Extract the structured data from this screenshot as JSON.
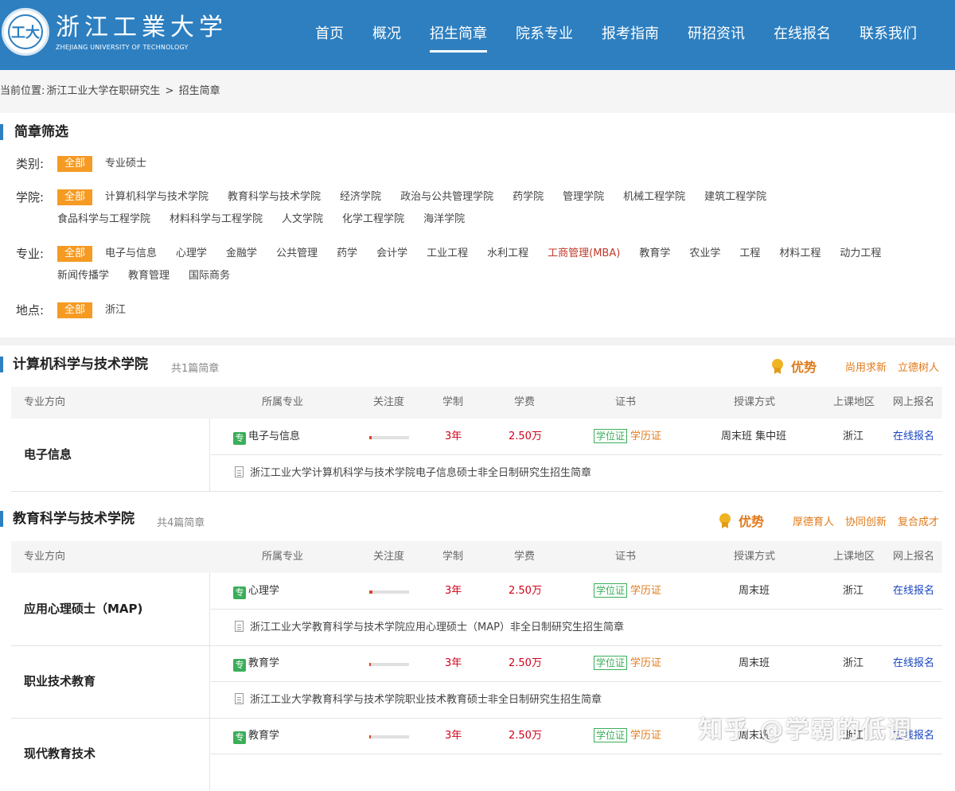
{
  "header": {
    "logo_cn": "浙江工業大学",
    "logo_en": "ZHEJIANG UNIVERSITY OF TECHNOLOGY",
    "logo_seal": "工大",
    "nav": [
      "首页",
      "概况",
      "招生简章",
      "院系专业",
      "报考指南",
      "研招资讯",
      "在线报名",
      "联系我们"
    ],
    "active_nav": "招生简章"
  },
  "breadcrumb": {
    "prefix": "当前位置:",
    "home": "浙江工业大学在职研究生",
    "sep": ">",
    "current": "招生简章"
  },
  "filter": {
    "title": "简章筛选",
    "all_label": "全部",
    "rows": [
      {
        "label": "类别:",
        "options": [
          "专业硕士"
        ]
      },
      {
        "label": "学院:",
        "options": [
          "计算机科学与技术学院",
          "教育科学与技术学院",
          "经济学院",
          "政治与公共管理学院",
          "药学院",
          "管理学院",
          "机械工程学院",
          "建筑工程学院",
          "食品科学与工程学院",
          "材料科学与工程学院",
          "人文学院",
          "化学工程学院",
          "海洋学院"
        ]
      },
      {
        "label": "专业:",
        "options": [
          "电子与信息",
          "心理学",
          "金融学",
          "公共管理",
          "药学",
          "会计学",
          "工业工程",
          "水利工程",
          "工商管理(MBA)",
          "教育学",
          "农业学",
          "工程",
          "材料工程",
          "动力工程",
          "新闻传播学",
          "教育管理",
          "国际商务"
        ],
        "highlight": "工商管理(MBA)"
      },
      {
        "label": "地点:",
        "options": [
          "浙江"
        ]
      }
    ]
  },
  "table_headers": [
    "专业方向",
    "所属专业",
    "关注度",
    "学制",
    "学费",
    "证书",
    "授课方式",
    "上课地区",
    "网上报名"
  ],
  "colleges": [
    {
      "name": "计算机科学与技术学院",
      "count": "共1篇简章",
      "adv_title": "优势",
      "adv_items": [
        "尚用求新",
        "立德树人"
      ],
      "majors": [
        {
          "direction": "电子信息",
          "tag": "专",
          "major": "电子与信息",
          "attention": 0.06,
          "duration": "3年",
          "fee": "2.50万",
          "cert1": "学位证",
          "cert2": "学历证",
          "mode": "周末班 集中班",
          "region": "浙江",
          "enroll": "在线报名",
          "brochure": "浙江工业大学计算机科学与技术学院电子信息硕士非全日制研究生招生简章"
        }
      ]
    },
    {
      "name": "教育科学与技术学院",
      "count": "共4篇简章",
      "adv_title": "优势",
      "adv_items": [
        "厚德育人",
        "协同创新",
        "复合成才"
      ],
      "majors": [
        {
          "direction": "应用心理硕士（MAP)",
          "tag": "专",
          "major": "心理学",
          "attention": 0.08,
          "duration": "3年",
          "fee": "2.50万",
          "cert1": "学位证",
          "cert2": "学历证",
          "mode": "周末班",
          "region": "浙江",
          "enroll": "在线报名",
          "brochure": "浙江工业大学教育科学与技术学院应用心理硕士（MAP）非全日制研究生招生简章"
        },
        {
          "direction": "职业技术教育",
          "tag": "专",
          "major": "教育学",
          "attention": 0.04,
          "duration": "3年",
          "fee": "2.50万",
          "cert1": "学位证",
          "cert2": "学历证",
          "mode": "周末班",
          "region": "浙江",
          "enroll": "在线报名",
          "brochure": "浙江工业大学教育科学与技术学院职业技术教育硕士非全日制研究生招生简章"
        },
        {
          "direction": "现代教育技术",
          "tag": "专",
          "major": "教育学",
          "attention": 0.04,
          "duration": "3年",
          "fee": "2.50万",
          "cert1": "学位证",
          "cert2": "学历证",
          "mode": "周末班",
          "region": "浙江",
          "enroll": "在线报名",
          "brochure": ""
        }
      ]
    }
  ],
  "watermark": "知乎 @学霸的低调"
}
